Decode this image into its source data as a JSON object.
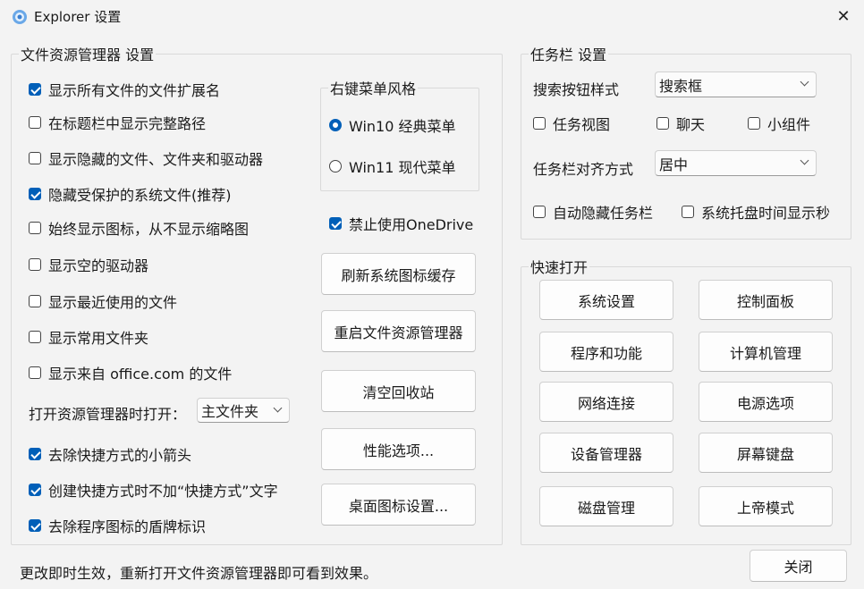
{
  "window": {
    "title": "Explorer 设置",
    "close_glyph": "✕"
  },
  "explorer_group": {
    "title": "文件资源管理器 设置",
    "options": [
      {
        "label": "显示所有文件的文件扩展名",
        "checked": true
      },
      {
        "label": "在标题栏中显示完整路径",
        "checked": false
      },
      {
        "label": "显示隐藏的文件、文件夹和驱动器",
        "checked": false
      },
      {
        "label": "隐藏受保护的系统文件(推荐)",
        "checked": true
      },
      {
        "label": "始终显示图标，从不显示缩略图",
        "checked": false
      },
      {
        "label": "显示空的驱动器",
        "checked": false
      },
      {
        "label": "显示最近使用的文件",
        "checked": false
      },
      {
        "label": "显示常用文件夹",
        "checked": false
      },
      {
        "label": "显示来自 office.com 的文件",
        "checked": false
      }
    ],
    "open_label": "打开资源管理器时打开：",
    "open_value": "主文件夹",
    "options2": [
      {
        "label": "去除快捷方式的小箭头",
        "checked": true
      },
      {
        "label": "创建快捷方式时不加“快捷方式”文字",
        "checked": true
      },
      {
        "label": "去除程序图标的盾牌标识",
        "checked": true
      }
    ],
    "context_menu": {
      "title": "右键菜单风格",
      "options": [
        {
          "label": "Win10 经典菜单",
          "selected": true
        },
        {
          "label": "Win11 现代菜单",
          "selected": false
        }
      ]
    },
    "onedrive": {
      "label": "禁止使用OneDrive",
      "checked": true
    },
    "buttons": [
      "刷新系统图标缓存",
      "重启文件资源管理器",
      "清空回收站",
      "性能选项...",
      "桌面图标设置..."
    ]
  },
  "taskbar_group": {
    "title": "任务栏 设置",
    "search_label": "搜索按钮样式",
    "search_value": "搜索框",
    "checks": [
      {
        "label": "任务视图",
        "checked": false
      },
      {
        "label": "聊天",
        "checked": false
      },
      {
        "label": "小组件",
        "checked": false
      }
    ],
    "align_label": "任务栏对齐方式",
    "align_value": "居中",
    "checks2": [
      {
        "label": "自动隐藏任务栏",
        "checked": false
      },
      {
        "label": "系统托盘时间显示秒",
        "checked": false
      }
    ]
  },
  "quick_group": {
    "title": "快速打开",
    "buttons": [
      "系统设置",
      "控制面板",
      "程序和功能",
      "计算机管理",
      "网络连接",
      "电源选项",
      "设备管理器",
      "屏幕键盘",
      "磁盘管理",
      "上帝模式"
    ]
  },
  "footer": {
    "status": "更改即时生效，重新打开文件资源管理器即可看到效果。",
    "close_button": "关闭"
  }
}
